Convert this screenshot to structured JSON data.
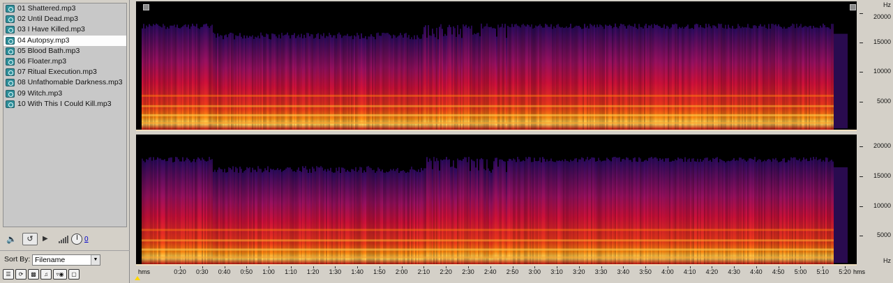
{
  "files": [
    {
      "name": "01 Shattered.mp3",
      "selected": false
    },
    {
      "name": "02 Until Dead.mp3",
      "selected": false
    },
    {
      "name": "03 I Have Killed.mp3",
      "selected": false
    },
    {
      "name": "04 Autopsy.mp3",
      "selected": true
    },
    {
      "name": "05 Blood Bath.mp3",
      "selected": false
    },
    {
      "name": "06 Floater.mp3",
      "selected": false
    },
    {
      "name": "07 Ritual Execution.mp3",
      "selected": false
    },
    {
      "name": "08 Unfathomable Darkness.mp3",
      "selected": false
    },
    {
      "name": "09 Witch.mp3",
      "selected": false
    },
    {
      "name": "10 With This I Could Kill.mp3",
      "selected": false
    }
  ],
  "transport": {
    "volume_value": "0"
  },
  "sort": {
    "label": "Sort By:",
    "value": "Filename"
  },
  "bottom_buttons": [
    "list-icon",
    "refresh-icon",
    "film-icon",
    "music-icon",
    "filter-icon",
    "tag-icon"
  ],
  "hz_axis": {
    "unit": "Hz",
    "labels": [
      "20000",
      "15000",
      "10000",
      "5000"
    ]
  },
  "time_axis": {
    "unit_left": "hms",
    "unit_right": "hms",
    "labels": [
      "0:20",
      "0:30",
      "0:40",
      "0:50",
      "1:00",
      "1:10",
      "1:20",
      "1:30",
      "1:40",
      "1:50",
      "2:00",
      "2:10",
      "2:20",
      "2:30",
      "2:40",
      "2:50",
      "3:00",
      "3:10",
      "3:20",
      "3:30",
      "3:40",
      "3:50",
      "4:00",
      "4:10",
      "4:20",
      "4:30",
      "4:40",
      "4:50",
      "5:00",
      "5:10",
      "5:20"
    ]
  },
  "spectrogram": {
    "channels": 2,
    "max_hz": 22000,
    "colors": {
      "low": "#2a0a5e",
      "mid": "#d0103a",
      "high": "#ff8a10",
      "peak": "#ffe060",
      "bg": "#000000"
    }
  }
}
